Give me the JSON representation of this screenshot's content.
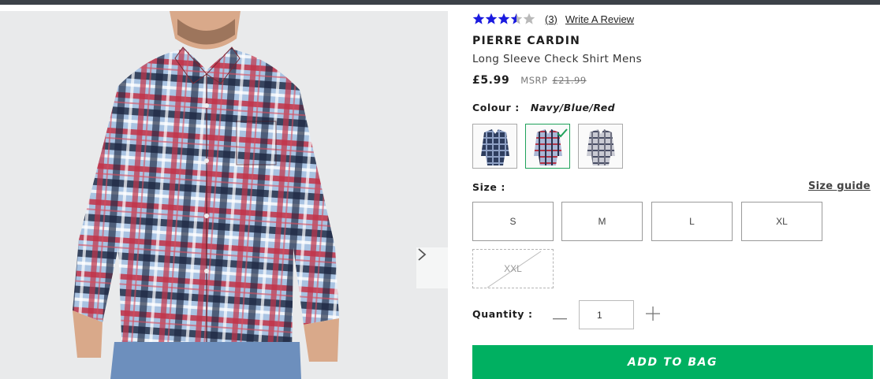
{
  "rating": {
    "stars": 3.5,
    "max_stars": 5,
    "review_count": "(3)",
    "write_review": "Write A Review",
    "star_color": "#1a1adf"
  },
  "product": {
    "brand": "PIERRE CARDIN",
    "name": "Long Sleeve Check Shirt Mens",
    "price": "£5.99",
    "msrp_label": "MSRP",
    "msrp": "£21.99"
  },
  "colour": {
    "label": "Colour :",
    "selected": "Navy/Blue/Red",
    "swatches": [
      {
        "name": "navy-check",
        "selected": false
      },
      {
        "name": "navy-blue-red",
        "selected": true
      },
      {
        "name": "grey-check",
        "selected": false
      }
    ],
    "selected_color": "#1fa15a"
  },
  "size": {
    "label": "Size :",
    "guide": "Size guide",
    "options": [
      {
        "label": "S",
        "available": true
      },
      {
        "label": "M",
        "available": true
      },
      {
        "label": "L",
        "available": true
      },
      {
        "label": "XL",
        "available": true
      },
      {
        "label": "XXL",
        "available": false
      }
    ]
  },
  "quantity": {
    "label": "Quantity :",
    "value": "1"
  },
  "cta": {
    "add_to_bag": "ADD TO BAG",
    "color": "#00b061"
  },
  "icons": {
    "next": "chevron-right-icon",
    "minus": "minus-icon",
    "plus": "plus-icon",
    "check": "checkmark-icon"
  }
}
